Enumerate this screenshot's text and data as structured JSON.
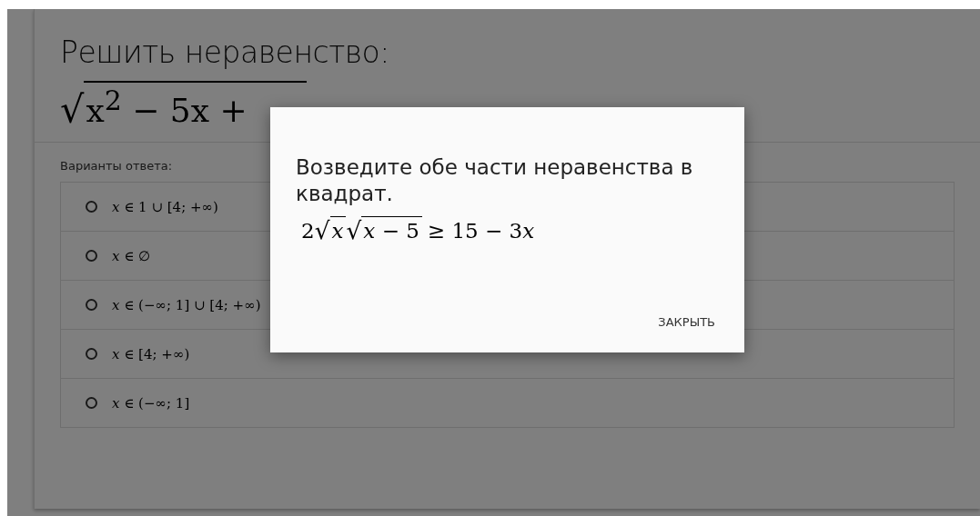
{
  "task": {
    "title": "Решить неравенство:",
    "formula": {
      "sign": "√",
      "radicand": "x$^{2}$ − 5x +"
    }
  },
  "answers": {
    "label": "Варианты ответа:",
    "options": [
      {
        "text": "*x* ∈ 1 ∪ [4; +∞)",
        "selected": false
      },
      {
        "text": "*x* ∈ ∅",
        "selected": false
      },
      {
        "text": "*x* ∈ (−∞; 1] ∪ [4; +∞)",
        "selected": false
      },
      {
        "text": "*x* ∈ [4; +∞)",
        "selected": false
      },
      {
        "text": "*x* ∈ (−∞; 1]",
        "selected": false
      }
    ]
  },
  "dialog": {
    "message": "Возведите обе части неравенства в квадрат.",
    "formula": [
      {
        "kind": "text",
        "text": "2"
      },
      {
        "kind": "root",
        "sign": "√",
        "radicand": "*x*"
      },
      {
        "kind": "root",
        "sign": "√",
        "radicand": "*x* − 5"
      },
      {
        "kind": "text",
        "text": "≥ 15 − 3"
      },
      {
        "kind": "var",
        "text": "x"
      }
    ],
    "close_button": "ЗАКРЫТЬ"
  }
}
